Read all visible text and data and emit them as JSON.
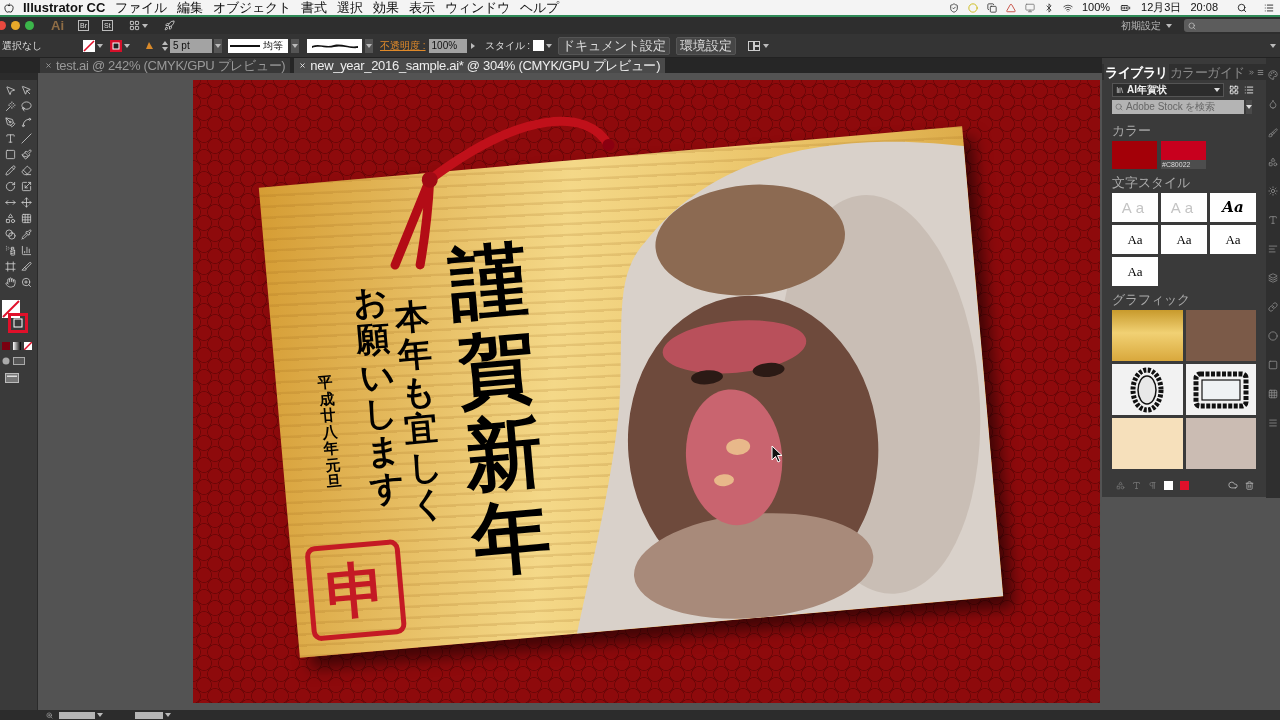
{
  "menu_bar": {
    "app_name": "Illustrator CC",
    "items": [
      "ファイル",
      "編集",
      "オブジェクト",
      "書式",
      "選択",
      "効果",
      "表示",
      "ウィンドウ",
      "ヘルプ"
    ],
    "battery": "100%",
    "date": "12月3日",
    "time": "20:08"
  },
  "app_bar": {
    "logo": "Ai",
    "apps": [
      "Br",
      "St"
    ],
    "workspace": "初期設定"
  },
  "control_bar": {
    "selection": "選択なし",
    "stroke_weight": "5 pt",
    "stroke_profile": "均等",
    "opacity_label": "不透明度 :",
    "opacity": "100%",
    "style_label": "スタイル :",
    "buttons": [
      "ドキュメント設定",
      "環境設定"
    ]
  },
  "document_tabs": [
    {
      "title": "test.ai @ 242% (CMYK/GPU プレビュー)",
      "selected": false
    },
    {
      "title": "new_year_2016_sample.ai* @ 304% (CMYK/GPU プレビュー)",
      "selected": true
    }
  ],
  "artwork": {
    "greeting": "謹賀新年",
    "message": [
      "本年も宜しく",
      "お願いします"
    ],
    "date": "平成廿八年元旦",
    "stamp": "申"
  },
  "libraries_panel": {
    "tabs": [
      {
        "label": "ライブラリ",
        "selected": true
      },
      {
        "label": "カラーガイド",
        "selected": false
      }
    ],
    "library": "AI年賀状",
    "search": {
      "placeholder": "Adobe Stock を検索"
    },
    "colors": {
      "title": "カラー",
      "swatches": [
        {
          "color": "#a30008"
        },
        {
          "color": "#c8001e",
          "label": "#C80022"
        }
      ]
    },
    "character_styles": {
      "title": "文字スタイル",
      "items": [
        {
          "sample": "Aa",
          "kind": "light"
        },
        {
          "sample": "Aa",
          "kind": "light"
        },
        {
          "sample": "Aa",
          "kind": "script"
        },
        {
          "sample": "Aa",
          "kind": "serif"
        },
        {
          "sample": "Aa",
          "kind": "serif"
        },
        {
          "sample": "Aa",
          "kind": "serif"
        },
        {
          "sample": "Aa",
          "kind": "serif"
        }
      ]
    },
    "graphics": {
      "title": "グラフィック",
      "items": [
        {
          "kind": "gold"
        },
        {
          "kind": "dark_photo"
        },
        {
          "kind": "oval_frame"
        },
        {
          "kind": "rect_frame"
        },
        {
          "kind": "beige"
        },
        {
          "kind": "light_photo"
        }
      ]
    }
  }
}
